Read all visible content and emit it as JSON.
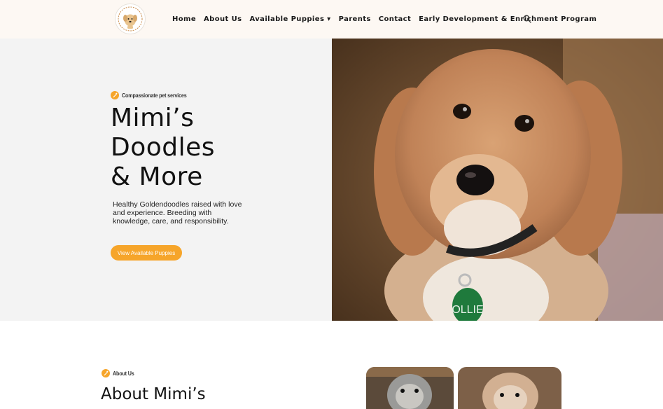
{
  "header": {
    "logo_name": "dog-logo",
    "nav": [
      {
        "label": "Home"
      },
      {
        "label": "About Us"
      },
      {
        "label": "Available Puppies ▾"
      },
      {
        "label": "Parents"
      },
      {
        "label": "Contact"
      },
      {
        "label": "Early Development & Enrichment Program"
      }
    ],
    "search_icon": "search-icon"
  },
  "hero": {
    "tag": "Compassionate pet services",
    "title_lines": [
      "Mimi’s",
      "Doodles",
      "& More"
    ],
    "description": "Healthy Goldendoodles raised with love and experience. Breeding with knowledge, care, and responsibility.",
    "cta_label": "View Available Puppies",
    "image_label": "goldendoodle-puppy-photo",
    "collar_tag_text": "OLLIE"
  },
  "about": {
    "tag": "About Us",
    "title": "About Mimi’s"
  },
  "colors": {
    "accent": "#f6a52a",
    "header_bg": "#fdf8f3",
    "hero_bg": "#f3f3f3"
  }
}
